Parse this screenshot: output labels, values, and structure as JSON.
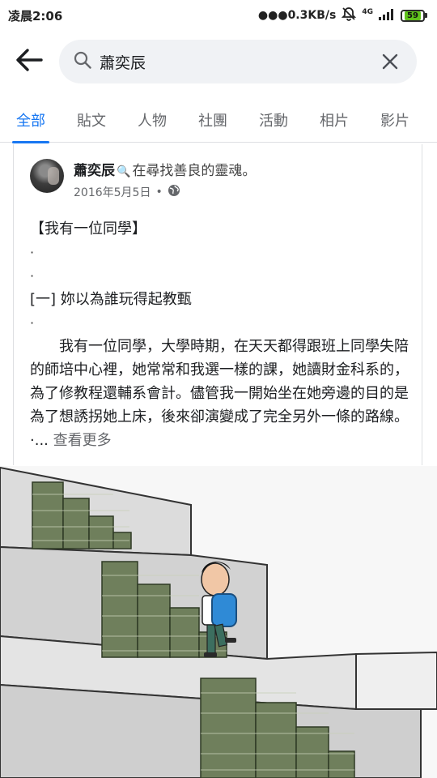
{
  "status_bar": {
    "time": "凌晨2:06",
    "net_speed": "●●●0.3KB/s",
    "network_type": "4G",
    "battery": "59",
    "icons": [
      "alarm-off-icon",
      "signal-icon",
      "battery-icon"
    ]
  },
  "search": {
    "query": "蕭奕辰",
    "icons": [
      "back-arrow-icon",
      "search-icon",
      "clear-icon"
    ]
  },
  "tabs": [
    {
      "label": "全部",
      "active": true
    },
    {
      "label": "貼文",
      "active": false
    },
    {
      "label": "人物",
      "active": false
    },
    {
      "label": "社團",
      "active": false
    },
    {
      "label": "活動",
      "active": false
    },
    {
      "label": "相片",
      "active": false
    },
    {
      "label": "影片",
      "active": false
    }
  ],
  "post": {
    "author": "蕭奕辰",
    "status_icon": "magnifier-emoji-icon",
    "status": "在尋找善良的靈魂。",
    "date": "2016年5月5日",
    "separator": "•",
    "privacy_icon": "globe-icon",
    "title": "【我有一位同學】",
    "dot": "·",
    "section": "[一] 妳以為誰玩得起教甄",
    "paragraph": "我有一位同學，大學時期，在天天都得跟班上同學失陪的師培中心裡，她常常和我選一樣的課，她讀財金科系的，為了修教程還輔系會計。儘管我一開始坐在她旁邊的目的是為了想誘拐她上床，後來卻演變成了完全另外一條的路線。",
    "ellipsis": "·...",
    "see_more": "查看更多",
    "image_desc": "cartoon-boy-climbing-money-stairs"
  },
  "colors": {
    "accent": "#1877f2",
    "search_bg": "#f0f2f5",
    "muted_text": "#65676b",
    "battery_fill": "#5fc21b"
  }
}
